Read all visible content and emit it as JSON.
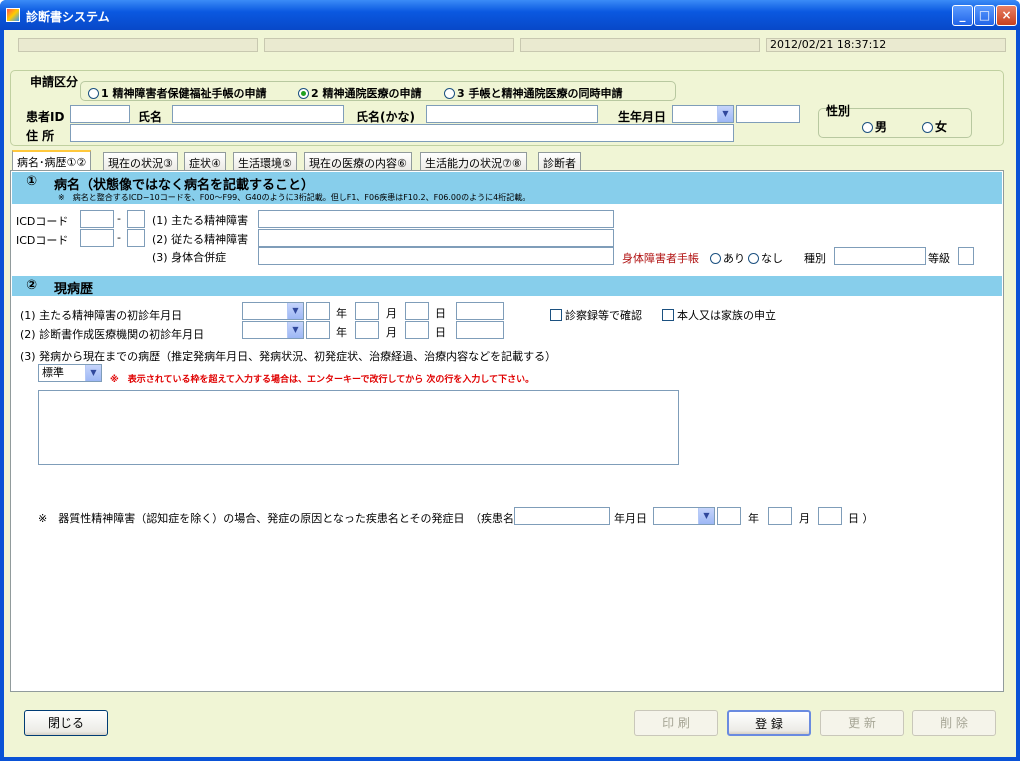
{
  "window": {
    "title": "診断書システム",
    "min": "_",
    "max": "□",
    "close": "×"
  },
  "status": {
    "datetime": "2012/02/21 18:37:12"
  },
  "application": {
    "label": "申請区分",
    "options": [
      "1 精神障害者保健福祉手帳の申請",
      "2 精神通院医療の申請",
      "3 手帳と精神通院医療の同時申請"
    ],
    "selected_index": 1
  },
  "patient": {
    "id_label": "患者ID",
    "name_label": "氏名",
    "kana_label": "氏名(かな)",
    "dob_label": "生年月日",
    "address_label": "住 所",
    "sex_label": "性別",
    "male": "男",
    "female": "女"
  },
  "tabs": [
    "病名･病歴①②",
    "現在の状況③",
    "症状④",
    "生活環境⑤",
    "現在の医療の内容⑥",
    "生活能力の状況⑦⑧",
    "診断者"
  ],
  "section1": {
    "number": "①",
    "title": "病名（状態像ではなく病名を記載すること）",
    "note": "※　病名と整合するICD−10コードを、F00〜F99、G40のように3桁記載。但しF1、F06疾患はF10.2、F06.00のように4桁記載。",
    "icd_label": "ICDコード",
    "dash": "-",
    "d1": "(1) 主たる精神障害",
    "d2": "(2) 従たる精神障害",
    "d3": "(3) 身体合併症",
    "handicap_label": "身体障害者手帳",
    "yes": "あり",
    "no": "なし",
    "kind_label": "種別",
    "grade_label": "等級"
  },
  "section2": {
    "number": "②",
    "title": "現病歴",
    "h1": "(1) 主たる精神障害の初診年月日",
    "h2": "(2) 診断書作成医療機関の初診年月日",
    "h3": "(3) 発病から現在までの病歴（推定発病年月日、発病状況、初発症状、治療経過、治療内容などを記載する）",
    "year": "年",
    "month": "月",
    "day": "日",
    "check1": "診察録等で確認",
    "check2": "本人又は家族の申立",
    "mode": "標準",
    "warning": "※　表示されている枠を超えて入力する場合は、エンターキーで改行してから 次の行を入力して下さい。",
    "organic_note": "※　器質性精神障害（認知症を除く）の場合、発症の原因となった疾患名とその発症日　（疾患名",
    "ymd_label": "年月日",
    "close_paren": "日 ）"
  },
  "buttons": {
    "close": "閉じる",
    "print": "印 刷",
    "register": "登 録",
    "update": "更 新",
    "delete": "削 除"
  }
}
